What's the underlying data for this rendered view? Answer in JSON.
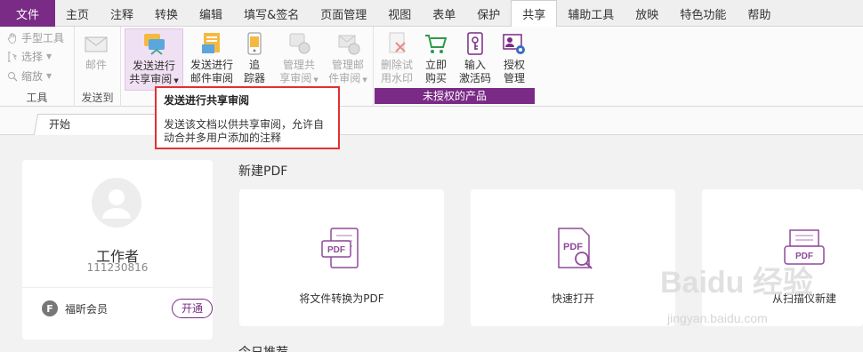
{
  "menu": {
    "file": "文件",
    "tabs": [
      "主页",
      "注释",
      "转换",
      "编辑",
      "填写&签名",
      "页面管理",
      "视图",
      "表单",
      "保护",
      "共享",
      "辅助工具",
      "放映",
      "特色功能",
      "帮助"
    ],
    "active_tab": "共享"
  },
  "ribbon": {
    "tools_group": {
      "hand": "手型工具",
      "select": "选择",
      "zoom": "缩放",
      "label": "工具"
    },
    "send_group": {
      "mail": "邮件",
      "label": "发送到"
    },
    "share_buttons": [
      {
        "l1": "发送进行",
        "l2": "共享审阅"
      },
      {
        "l1": "发送进行",
        "l2": "邮件审阅"
      },
      {
        "l1": "追",
        "l2": "踪器"
      },
      {
        "l1": "管理共",
        "l2": "享审阅"
      },
      {
        "l1": "管理邮",
        "l2": "件审阅"
      }
    ],
    "product_buttons": [
      {
        "l1": "删除试",
        "l2": "用水印"
      },
      {
        "l1": "立即",
        "l2": "购买"
      },
      {
        "l1": "输入",
        "l2": "激活码"
      },
      {
        "l1": "授权",
        "l2": "管理"
      }
    ],
    "unlicensed_label": "未授权的产品"
  },
  "tooltip": {
    "title": "发送进行共享审阅",
    "description": "发送该文档以供共享审阅，允许自动合并多用户添加的注释"
  },
  "doc_tab": "开始",
  "user": {
    "name": "工作者",
    "id": "111230816",
    "member": "福昕会员",
    "open_button": "开通"
  },
  "new_pdf": {
    "title": "新建PDF",
    "cards": [
      "将文件转换为PDF",
      "快速打开",
      "从扫描仪新建"
    ]
  },
  "bottom_section_title": "今日推荐",
  "watermark": {
    "line1": "Baidu 经验",
    "line2": "jingyan.baidu.com"
  },
  "colors": {
    "brand": "#7a2b86",
    "tooltip_border": "#e23131"
  }
}
